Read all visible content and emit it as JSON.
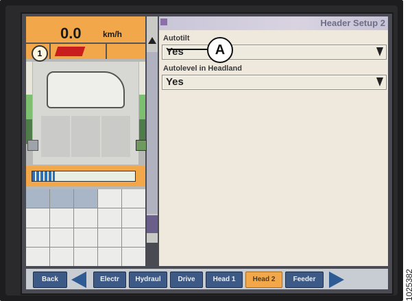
{
  "status": {
    "speed_value": "0.0",
    "speed_unit": "km/h",
    "gear": "1",
    "header_fill_percent": 90,
    "load_fill_percent": 22
  },
  "window": {
    "title": "Header Setup 2"
  },
  "fields": [
    {
      "label": "Autotilt",
      "value": "Yes"
    },
    {
      "label": "Autolevel in Headland",
      "value": "Yes"
    }
  ],
  "callout": {
    "label": "A"
  },
  "tabs": [
    {
      "label": "Back",
      "active": false
    },
    {
      "label": "Electr",
      "active": false
    },
    {
      "label": "Hydraul",
      "active": false
    },
    {
      "label": "Drive",
      "active": false
    },
    {
      "label": "Head 1",
      "active": false
    },
    {
      "label": "Head 2",
      "active": true
    },
    {
      "label": "Feeder",
      "active": false
    }
  ],
  "reference_number": "1025382",
  "icons": {
    "scroll_up": "triangle-up",
    "previous": "triangle-left",
    "next": "triangle-right",
    "dropdown": "triangle-down"
  }
}
